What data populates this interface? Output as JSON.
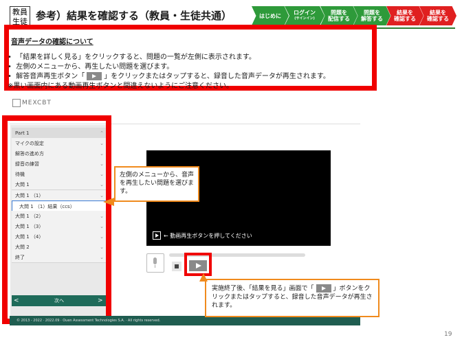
{
  "header": {
    "label_line1": "教員",
    "label_line2": "生徒",
    "title": "参考）結果を確認する（教員・生徒共通）",
    "steps": [
      {
        "label": "はじめに",
        "sub": "",
        "color": "#2e9a3a"
      },
      {
        "label": "ログイン",
        "sub": "(サインイン)",
        "color": "#2e9a3a"
      },
      {
        "label": "問題を\n配信する",
        "sub": "",
        "color": "#2e9a3a"
      },
      {
        "label": "問題を\n解答する",
        "sub": "",
        "color": "#2e9a3a"
      },
      {
        "label": "結果を\n確認する",
        "sub": "",
        "color": "#e02020"
      },
      {
        "label": "結果を\n確認する",
        "sub": "",
        "color": "#e02020"
      }
    ]
  },
  "callout": {
    "title": "音声データの確認について",
    "line1": "「結果を詳しく見る」をクリックすると、問題の一覧が左側に表示されます。",
    "line2": "左側のメニューから、再生したい問題を選びます。",
    "line3a": "解答音声再生ボタン「",
    "line3b": "」をクリックまたはタップすると、録音した音声データが再生されます。",
    "line4": "※黒い画面内にある動画再生ボタンと間違えないようにご注意ください。"
  },
  "app": {
    "logo": "MEXCBT"
  },
  "sidebar": {
    "items": [
      {
        "label": "Part 1"
      },
      {
        "label": "マイクの設定"
      },
      {
        "label": "解答の進め方"
      },
      {
        "label": "録音の練習"
      },
      {
        "label": "待機"
      },
      {
        "label": "大問 1"
      },
      {
        "label": "大問 1 （1）"
      },
      {
        "label": "大問 1 （1）結果（ccs）"
      },
      {
        "label": "大問 1 （2）"
      },
      {
        "label": "大問 1 （3）"
      },
      {
        "label": "大問 1 （4）"
      },
      {
        "label": "大問 2"
      },
      {
        "label": "終了"
      }
    ],
    "nav_prev": "<",
    "nav_label": "次へ",
    "nav_next": ">"
  },
  "video": {
    "caption": "← 動画再生ボタンを押してください"
  },
  "notes": {
    "left_note": "左側のメニューから、音声を再生したい問題を選びます。",
    "bottom_note_a": "実施終了後、「結果を見る」画面で「",
    "bottom_note_b": "」ボタンをクリックまたはタップすると、録音した音声データが再生されます。"
  },
  "footer": {
    "text": "© 2013 - 2022 · 2022.09 · Ouen Assessment Technologies S.A. · All rights reserved."
  },
  "page_number": "19"
}
